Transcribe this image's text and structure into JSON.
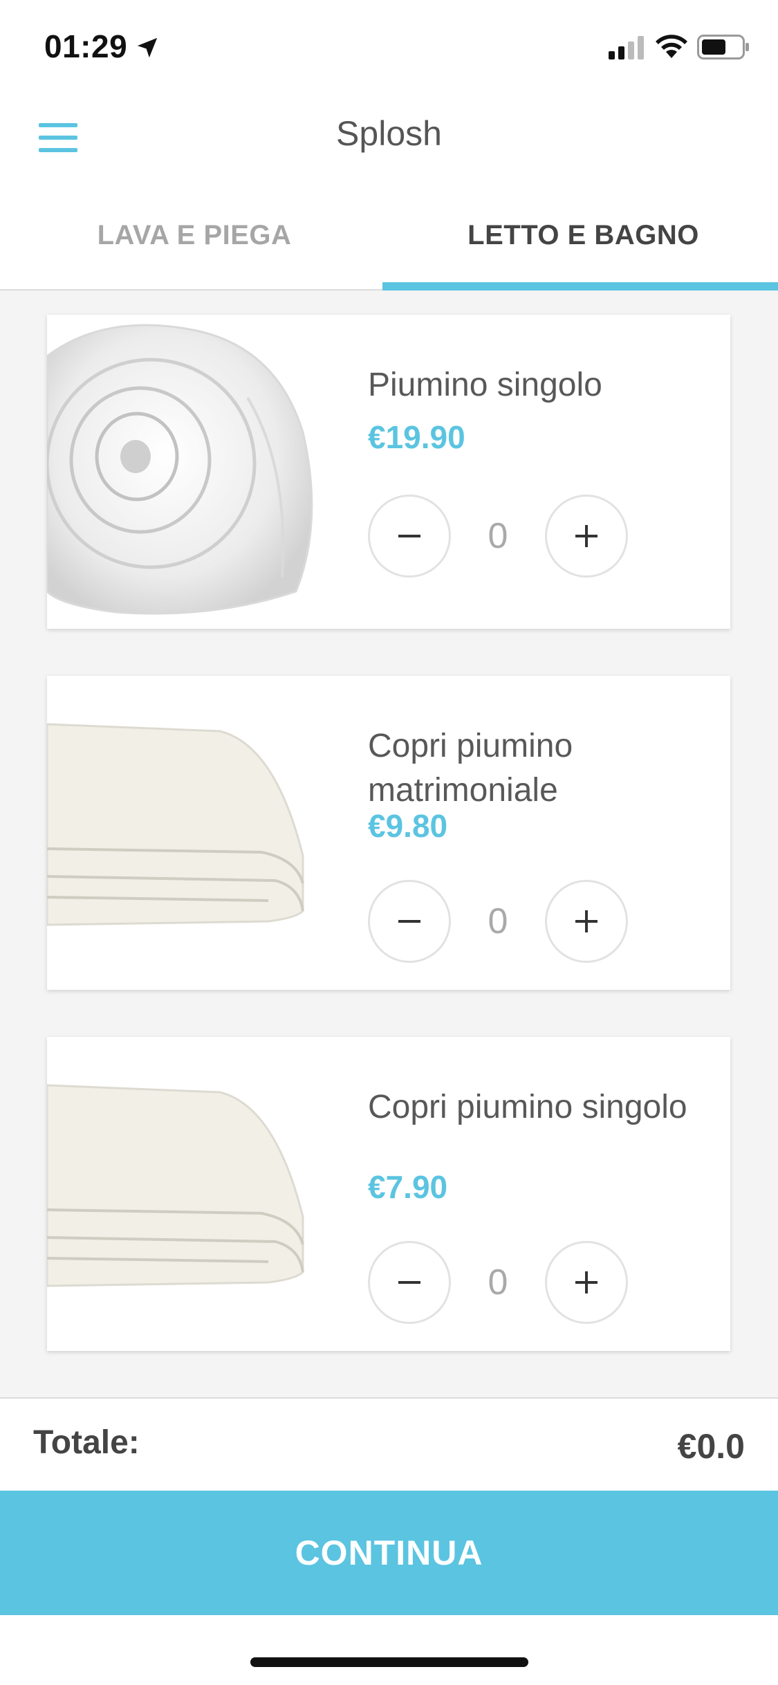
{
  "status_bar": {
    "time": "01:29"
  },
  "header": {
    "title": "Splosh"
  },
  "tabs": [
    {
      "label": "LAVA E PIEGA",
      "active": false
    },
    {
      "label": "LETTO E BAGNO",
      "active": true
    }
  ],
  "products": [
    {
      "name": "Piumino singolo",
      "price": "€19.90",
      "quantity": "0",
      "image": "rolled-duvet"
    },
    {
      "name": "Copri piumino matrimoniale",
      "price": "€9.80",
      "quantity": "0",
      "image": "folded-cover"
    },
    {
      "name": "Copri piumino singolo",
      "price": "€7.90",
      "quantity": "0",
      "image": "folded-cover"
    }
  ],
  "footer": {
    "total_label": "Totale:",
    "total_value": "€0.0",
    "continue_label": "CONTINUA"
  },
  "colors": {
    "accent": "#5bc4e1",
    "text": "#555555",
    "background": "#f4f4f4"
  }
}
